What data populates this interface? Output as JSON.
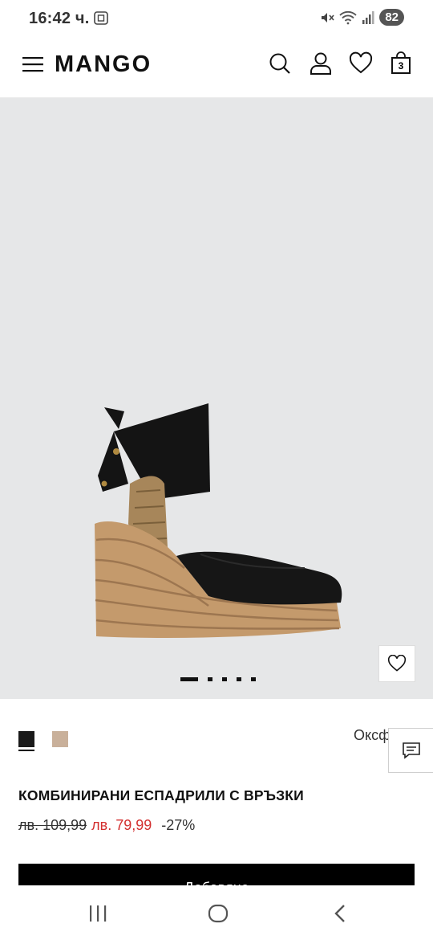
{
  "status": {
    "time": "16:42 ч.",
    "battery": "82",
    "icons": [
      "screenshot-icon",
      "mute-icon",
      "wifi-icon",
      "signal-icon"
    ]
  },
  "header": {
    "logo": "MANGO",
    "cart_count": "3",
    "icons": [
      "menu-icon",
      "search-icon",
      "account-icon",
      "wishlist-icon",
      "bag-icon"
    ]
  },
  "gallery": {
    "current_image": 1,
    "total_images": 5,
    "background": "#e6e7e8"
  },
  "product": {
    "color_name": "Оксфорд",
    "title": "КОМБИНИРАНИ ЕСПАДРИЛИ С ВРЪЗКИ",
    "price_old": "лв. 109,99",
    "price_new": "лв. 79,99",
    "discount": "-27%",
    "swatches": [
      {
        "color": "#1a1a1a",
        "selected": true
      },
      {
        "color": "#c9b09a",
        "selected": false
      }
    ]
  },
  "actions": {
    "add_label": "Добавяне"
  },
  "colors": {
    "accent_sale": "#d32f2f",
    "primary": "#000000"
  }
}
